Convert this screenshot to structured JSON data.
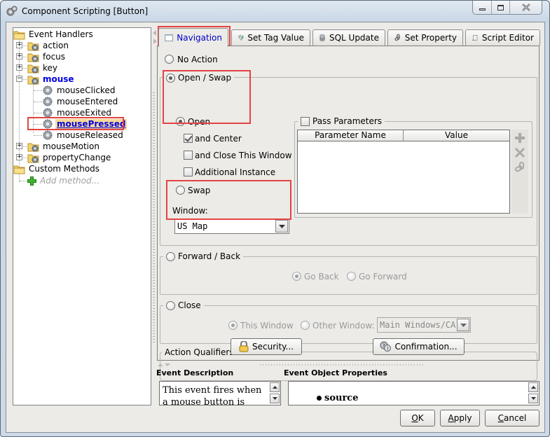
{
  "window": {
    "title": "Component Scripting [Button]",
    "controls": {
      "minimize": "minimize",
      "maximize": "maximize",
      "close": "close"
    }
  },
  "tree": {
    "root_event_handlers": "Event Handlers",
    "handlers": [
      {
        "label": "action",
        "expanded": false
      },
      {
        "label": "focus",
        "expanded": false
      },
      {
        "label": "key",
        "expanded": false
      },
      {
        "label": "mouse",
        "expanded": true
      },
      {
        "label": "mouseMotion",
        "expanded": false
      },
      {
        "label": "propertyChange",
        "expanded": false
      }
    ],
    "mouse_children": [
      "mouseClicked",
      "mouseEntered",
      "mouseExited",
      "mousePressed",
      "mouseReleased"
    ],
    "selected": "mousePressed",
    "root_custom_methods": "Custom Methods",
    "add_method": "Add method..."
  },
  "tabs": [
    {
      "label": "Navigation",
      "icon": "window-icon",
      "active": true
    },
    {
      "label": "Set Tag Value",
      "icon": "tag-pencil-icon",
      "active": false
    },
    {
      "label": "SQL Update",
      "icon": "database-icon",
      "active": false
    },
    {
      "label": "Set Property",
      "icon": "chain-link-icon",
      "active": false
    },
    {
      "label": "Script Editor",
      "icon": "scroll-icon",
      "active": false
    }
  ],
  "navigation": {
    "no_action": {
      "label": "No Action",
      "selected": false
    },
    "open_swap": {
      "label": "Open / Swap",
      "selected": true,
      "open": {
        "label": "Open",
        "selected": true
      },
      "and_center": {
        "label": "and Center",
        "checked": true
      },
      "and_close_this_window": {
        "label": "and Close This Window",
        "checked": false
      },
      "additional_instance": {
        "label": "Additional Instance",
        "checked": false
      },
      "swap": {
        "label": "Swap",
        "selected": false
      },
      "window_label": "Window:",
      "window_value": "US Map",
      "pass_parameters": {
        "label": "Pass Parameters",
        "checked": false,
        "columns": [
          "Parameter Name",
          "Value"
        ],
        "rows": []
      }
    },
    "forward_back": {
      "label": "Forward / Back",
      "selected": false,
      "go_back": {
        "label": "Go Back",
        "selected": true
      },
      "go_forward": {
        "label": "Go Forward",
        "selected": false
      }
    },
    "close": {
      "label": "Close",
      "selected": false,
      "this_window": {
        "label": "This Window",
        "selected": true
      },
      "other_window": {
        "label": "Other Window:",
        "selected": false
      },
      "other_window_value": "Main Windows/CA"
    },
    "action_qualifiers": {
      "label": "Action Qualifiers",
      "security_button": "Security...",
      "confirmation_button": "Confirmation..."
    }
  },
  "event_description": {
    "label": "Event Description",
    "text": "This event fires when a mouse button is pressed"
  },
  "event_object_properties": {
    "label": "Event Object Properties",
    "items": [
      "source"
    ]
  },
  "buttons": {
    "ok": {
      "mnemonic": "O",
      "rest": "K"
    },
    "apply": {
      "mnemonic": "A",
      "rest": "pply"
    },
    "cancel": {
      "mnemonic": "C",
      "rest": "ancel"
    }
  }
}
